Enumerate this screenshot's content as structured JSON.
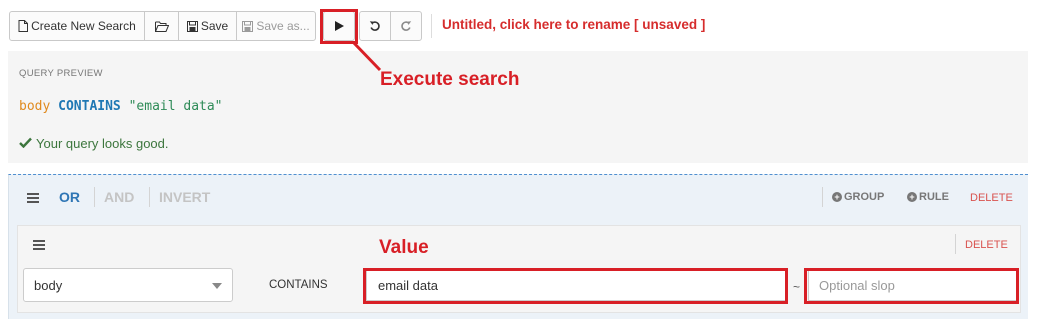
{
  "toolbar": {
    "create_new_search": "Create New Search",
    "save": "Save",
    "save_as": "Save as..."
  },
  "document": {
    "title": "Untitled, click here to rename [ unsaved ]"
  },
  "preview": {
    "heading": "QUERY PREVIEW",
    "field_token": "body",
    "operator_token": "CONTAINS",
    "value_token": "\"email data\"",
    "status": "Your query looks good."
  },
  "group": {
    "conditions": [
      "OR",
      "AND",
      "INVERT"
    ],
    "active_condition": "OR",
    "add_group_label": "GROUP",
    "add_rule_label": "RULE",
    "delete_label": "DELETE"
  },
  "rule": {
    "field": "body",
    "operator": "CONTAINS",
    "value": "email data",
    "separator": "~",
    "slop_placeholder": "Optional slop",
    "delete_label": "DELETE"
  },
  "annotations": {
    "execute": "Execute search",
    "value": "Value"
  },
  "colors": {
    "annotation": "#d81f26",
    "title": "#d62d2d",
    "active_condition": "#2f76b5",
    "inactive_condition": "#c4c4c4",
    "status_ok": "#3c763d",
    "delete": "#d9534f"
  },
  "icons": [
    "file-icon",
    "folder-open-icon",
    "save-icon",
    "play-icon",
    "undo-icon",
    "redo-icon",
    "check-icon",
    "hamburger-icon",
    "plus-circle-icon",
    "caret-down-icon"
  ]
}
